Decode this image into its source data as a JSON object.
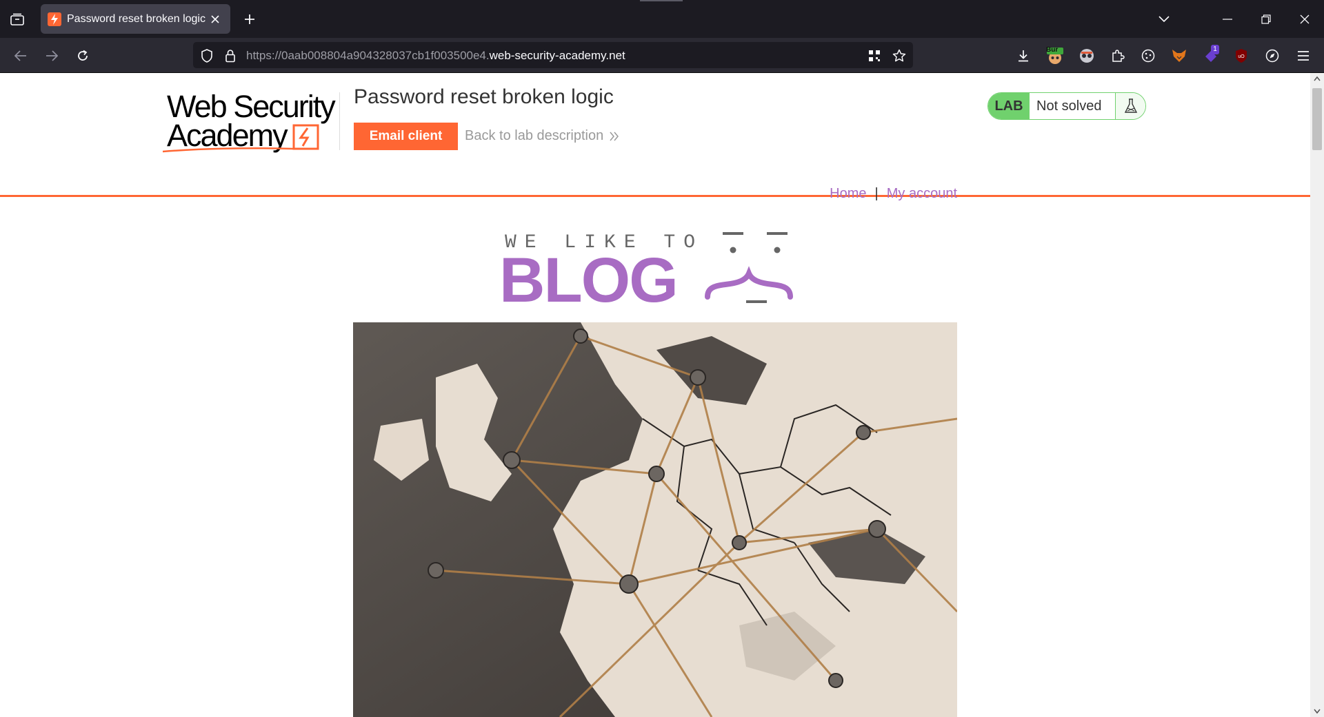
{
  "browser": {
    "tab_title": "Password reset broken logic",
    "url_prefix": "https://0aab008804a904328037cb1f003500e4.",
    "url_host": "web-security-academy.net",
    "extensions": [
      {
        "name": "burp-extension",
        "badge": "Bur"
      },
      {
        "name": "notification-extension",
        "badge": "1"
      }
    ]
  },
  "header": {
    "logo_line1": "Web Security",
    "logo_line2": "Academy",
    "lab_title": "Password reset broken logic",
    "email_client_label": "Email client",
    "back_link_label": "Back to lab description",
    "lab_badge": "LAB",
    "lab_state": "Not solved",
    "accent_color": "#ff6633",
    "solved_status_color": "#70d16d"
  },
  "site_nav": {
    "home_label": "Home",
    "separator": "|",
    "account_label": "My account",
    "link_color": "#a86cc3"
  },
  "banner": {
    "tagline": "WE LIKE TO",
    "title": "BLOG"
  },
  "hero": {
    "image_subject": "europe-map-with-pins-and-string"
  }
}
